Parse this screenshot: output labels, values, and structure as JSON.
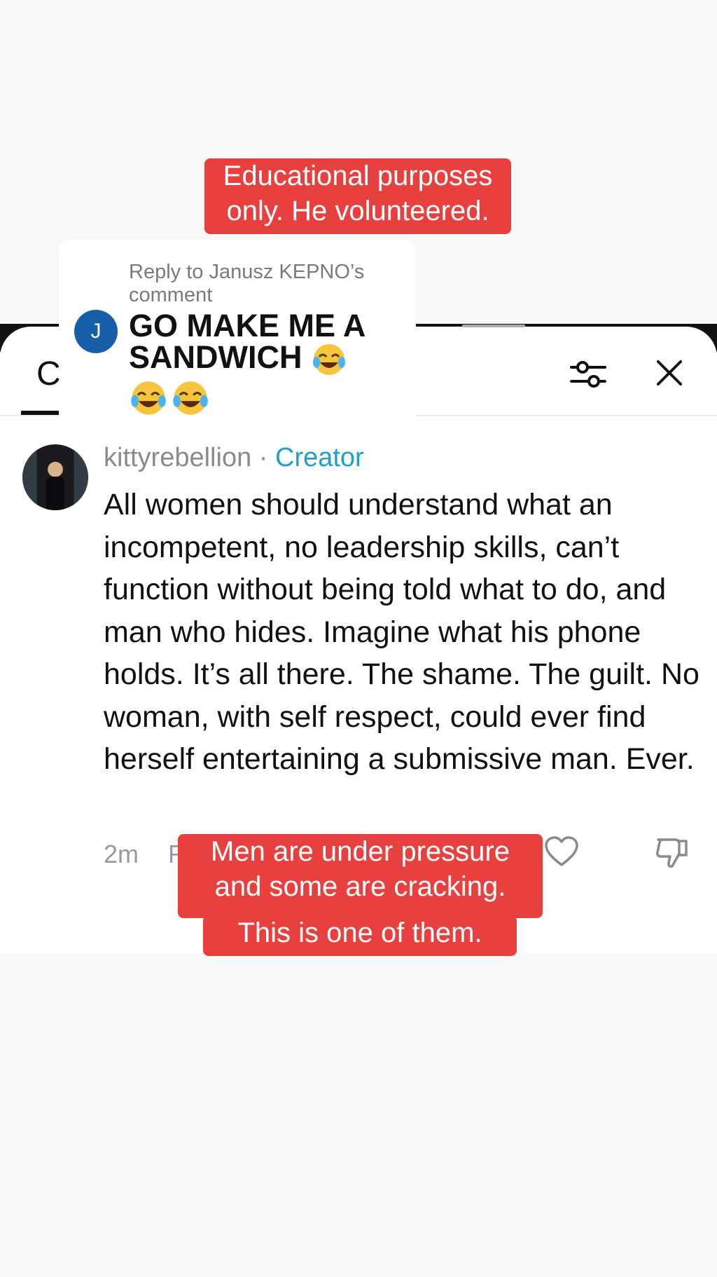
{
  "captions": {
    "top": [
      "Educational purposes",
      "only. He volunteered."
    ],
    "bottom": [
      "Men are under pressure",
      "and some are cracking.",
      "This is one of them."
    ]
  },
  "reply_card": {
    "avatar_letter": "J",
    "reply_to": "Reply to Janusz KEPNO’s comment",
    "text": "GO MAKE ME A SANDWICH",
    "emoji_name": "face-with-tears-of-joy-icon",
    "emoji_count": 3
  },
  "sheet": {
    "tab_label": "C",
    "icons": [
      "filter-icon",
      "close-icon"
    ]
  },
  "comment": {
    "username": "kittyrebellion",
    "separator": " · ",
    "badge": "Creator",
    "body": "All women should understand what an incompetent, no leadership skills, can’t function without being told what to do, and man who hides. Imagine what his phone holds. It’s all there. The shame. The guilt. No woman, with self respect, could ever find herself entertaining a submissive man. Ever.",
    "time": "2m",
    "reply_peek": "R",
    "icons": [
      "heart-icon",
      "thumbs-down-icon"
    ]
  },
  "colors": {
    "caption_bg": "#e8403e",
    "creator_badge": "#1ea0c8",
    "reply_avatar": "#175ea8"
  }
}
